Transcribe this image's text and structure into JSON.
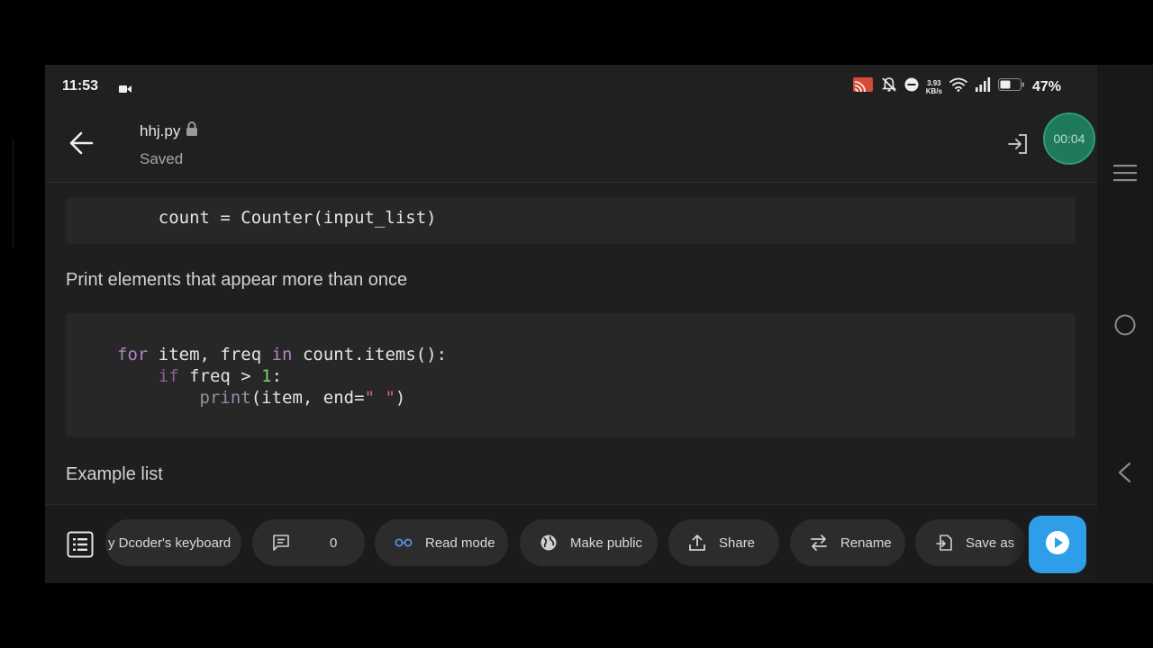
{
  "status_bar": {
    "time": "11:53",
    "net_speed_value": "3.93",
    "net_speed_unit": "KB/s",
    "battery": "47%"
  },
  "app_bar": {
    "filename": "hhj.py",
    "save_state": "Saved"
  },
  "content": {
    "code_block_1": "    count = Counter(input_list)",
    "paragraph_1": "Print elements that appear more than once",
    "code_block_2": {
      "l1_for": "for",
      "l1_a": " item, freq ",
      "l1_in": "in",
      "l1_b": " count.items():",
      "l2_indent": "    ",
      "l2_if": "if",
      "l2_a": " freq > ",
      "l2_num": "1",
      "l2_b": ":",
      "l3_indent": "        ",
      "l3_fn": "print",
      "l3_a": "(item, end=",
      "l3_str": "\" \"",
      "l3_b": ")"
    },
    "paragraph_2": "Example list"
  },
  "toolbar": {
    "keyboard_label": "y Dcoder's keyboard",
    "comments_count": "0",
    "read_mode": "Read mode",
    "make_public": "Make public",
    "share": "Share",
    "rename": "Rename",
    "save_as": "Save as"
  },
  "timer": {
    "value": "00:04"
  },
  "colors": {
    "run_button": "#2f9ee8",
    "timer_bubble": "#1f7a5a",
    "keyword": "#b383c4",
    "number": "#7fcf7f",
    "string": "#e0608a"
  }
}
